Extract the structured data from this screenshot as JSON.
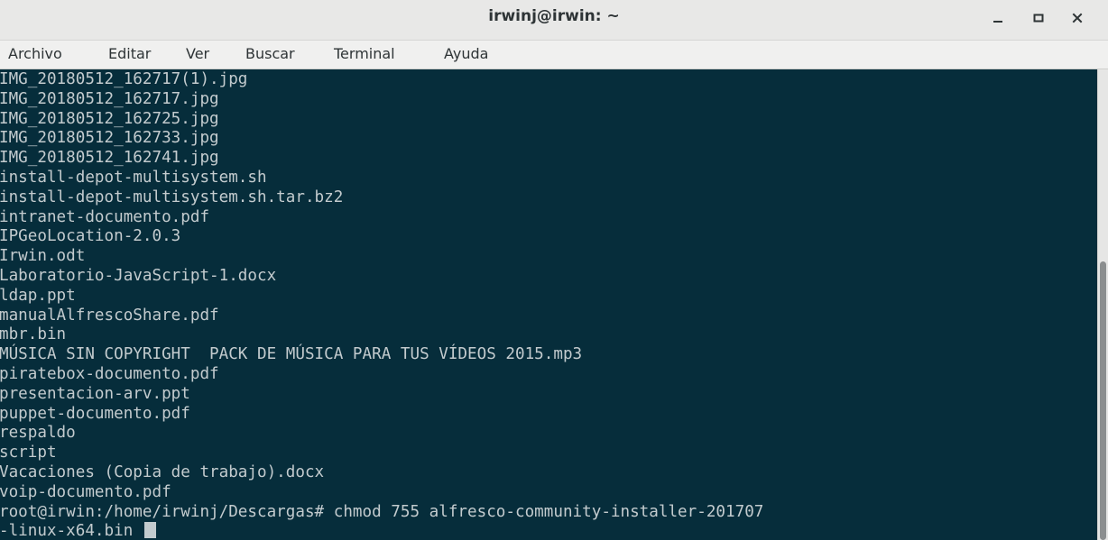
{
  "window": {
    "title": "irwinj@irwin: ~",
    "controls": {
      "minimize_icon": "minimize-icon",
      "maximize_icon": "maximize-icon",
      "close_icon": "close-icon"
    }
  },
  "menubar": {
    "items": [
      {
        "label": "Archivo"
      },
      {
        "label": "Editar"
      },
      {
        "label": "Ver"
      },
      {
        "label": "Buscar"
      },
      {
        "label": "Terminal"
      },
      {
        "label": "Ayuda"
      }
    ]
  },
  "terminal": {
    "background": "#062d3b",
    "foreground": "#c3cbce",
    "lines": [
      "IMG_20180512_162717(1).jpg",
      "IMG_20180512_162717.jpg",
      "IMG_20180512_162725.jpg",
      "IMG_20180512_162733.jpg",
      "IMG_20180512_162741.jpg",
      "install-depot-multisystem.sh",
      "install-depot-multisystem.sh.tar.bz2",
      "intranet-documento.pdf",
      "IPGeoLocation-2.0.3",
      "Irwin.odt",
      "Laboratorio-JavaScript-1.docx",
      "ldap.ppt",
      "manualAlfrescoShare.pdf",
      "mbr.bin",
      "MÚSICA SIN COPYRIGHT  PACK DE MÚSICA PARA TUS VÍDEOS 2015.mp3",
      "piratebox-documento.pdf",
      "presentacion-arv.ppt",
      "puppet-documento.pdf",
      "respaldo",
      "script",
      "Vacaciones (Copia de trabajo).docx",
      "voip-documento.pdf",
      "root@irwin:/home/irwinj/Descargas# chmod 755 alfresco-community-installer-201707"
    ],
    "last_line": "-linux-x64.bin "
  }
}
